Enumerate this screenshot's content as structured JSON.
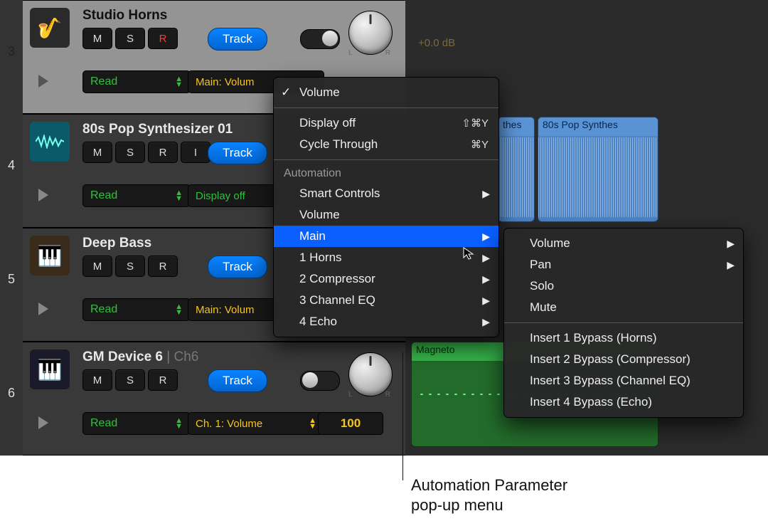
{
  "arrange": {
    "db_label": "+0.0 dB",
    "regions": {
      "synth1": "thes",
      "synth2": "80s Pop Synthes",
      "magneto": "Magneto"
    }
  },
  "tracks": [
    {
      "num": "3",
      "name": "Studio Horns",
      "icon": "🎷",
      "btns": [
        "M",
        "S",
        "R"
      ],
      "track_btn": "Track",
      "mode": "Read",
      "param": "Main: Volum",
      "param_style": "y",
      "selected": true,
      "toggle": "on"
    },
    {
      "num": "4",
      "name": "80s Pop Synthesizer 01",
      "icon": "wave",
      "btns": [
        "M",
        "S",
        "R",
        "I"
      ],
      "track_btn": "Track",
      "mode": "Read",
      "param": "Display off",
      "param_style": "g",
      "selected": false
    },
    {
      "num": "5",
      "name": "Deep Bass",
      "icon": "🎹",
      "btns": [
        "M",
        "S",
        "R"
      ],
      "track_btn": "Track",
      "mode": "Read",
      "param": "Main: Volum",
      "param_style": "y",
      "selected": false
    },
    {
      "num": "6",
      "name": "GM Device 6",
      "name_suffix": " | Ch6",
      "icon": "🎹",
      "btns": [
        "M",
        "S",
        "R"
      ],
      "track_btn": "Track",
      "mode": "Read",
      "param": "Ch. 1: Volume",
      "param_style": "y",
      "value": "100",
      "selected": false,
      "toggle": "off"
    }
  ],
  "menu1": {
    "checked": "Volume",
    "items_top": [
      {
        "label": "Display off",
        "shortcut": "⇧⌘Y"
      },
      {
        "label": "Cycle Through",
        "shortcut": "⌘Y"
      }
    ],
    "section": "Automation",
    "items_auto": [
      {
        "label": "Smart Controls",
        "sub": true
      },
      {
        "label": "Volume",
        "sub": false
      },
      {
        "label": "Main",
        "sub": true,
        "hl": true
      },
      {
        "label": "1 Horns",
        "sub": true
      },
      {
        "label": "2 Compressor",
        "sub": true
      },
      {
        "label": "3 Channel EQ",
        "sub": true
      },
      {
        "label": "4 Echo",
        "sub": true
      }
    ]
  },
  "menu2": {
    "items_top": [
      {
        "label": "Volume",
        "sub": true
      },
      {
        "label": "Pan",
        "sub": true
      },
      {
        "label": "Solo"
      },
      {
        "label": "Mute"
      }
    ],
    "items_ins": [
      {
        "label": "Insert 1 Bypass (Horns)"
      },
      {
        "label": "Insert 2 Bypass (Compressor)"
      },
      {
        "label": "Insert 3 Bypass (Channel EQ)"
      },
      {
        "label": "Insert 4 Bypass (Echo)"
      }
    ]
  },
  "callout": {
    "line1": "Automation Parameter",
    "line2": "pop-up menu"
  },
  "pan_labels": {
    "l": "L",
    "r": "R"
  }
}
